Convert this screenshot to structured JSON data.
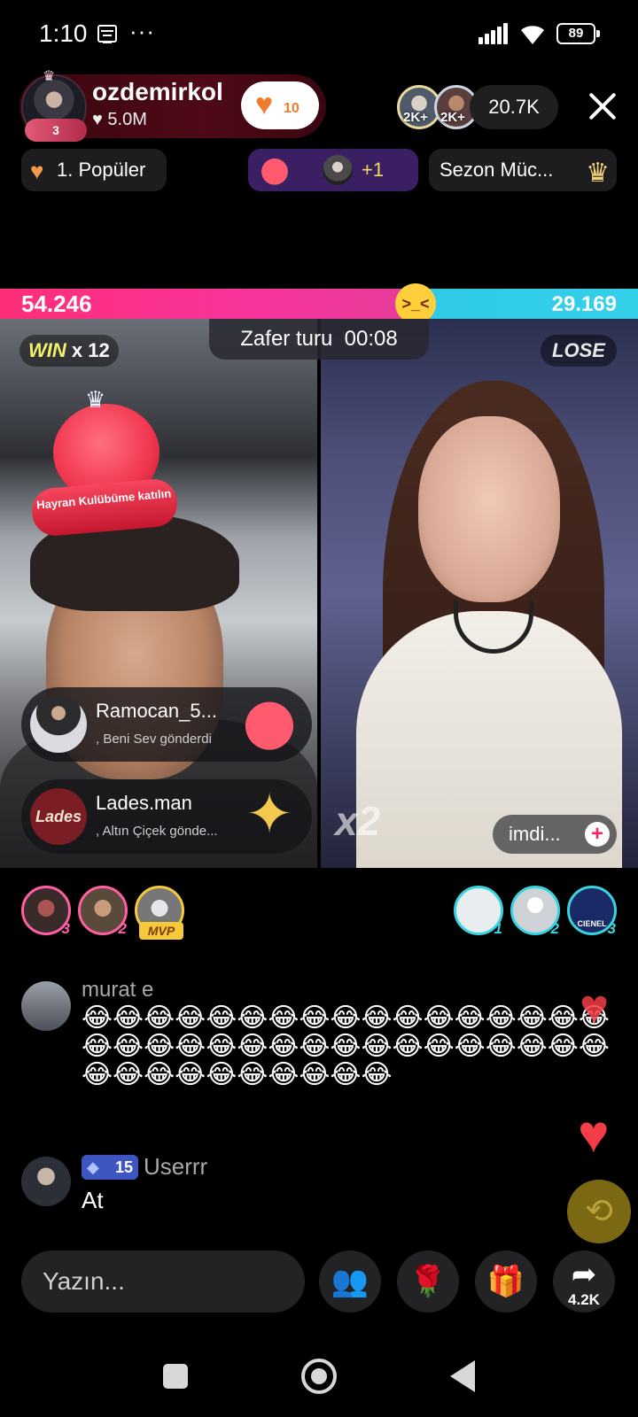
{
  "status_bar": {
    "time": "1:10",
    "more": "···",
    "battery": "89",
    "icons": [
      "calendar-icon",
      "signal-icon",
      "wifi-icon",
      "battery-icon"
    ]
  },
  "host": {
    "name": "ozdemirkol",
    "likes": "♥ 5.0M",
    "badge_level": "3",
    "follow_count": "10"
  },
  "viewers": {
    "top_badges": [
      "2K+",
      "2K+"
    ],
    "count": "20.7K"
  },
  "chips": {
    "popular": "1. Popüler",
    "gift_extra": "+1",
    "season": "Sezon Müc..."
  },
  "battle": {
    "score_left": "54.246",
    "score_right": "29.169",
    "score_emoji": ">_<",
    "timer_label": "Zafer turu",
    "timer_value": "00:08",
    "win_word": "WIN",
    "win_streak": "x 12",
    "lose_word": "LOSE",
    "multiplier": "x2",
    "fanclub_text": "Hayran Kulübüme katılın",
    "invite": "imdi..."
  },
  "gift_toasts": [
    {
      "name": "Ramocan_5...",
      "sub": ", Beni Sev  gönderdi"
    },
    {
      "name": "Lades.man",
      "sub": ", Altın Çiçek  gönde...",
      "avatar_text": "Lades"
    }
  ],
  "ranks": {
    "left": [
      "3",
      "2",
      "MVP"
    ],
    "right": [
      "1",
      "2",
      "3"
    ],
    "right_label": "CIENEL"
  },
  "chat": [
    {
      "user": "murat e",
      "text": "😂😂😂😂😂😂😂😂😂😂😂😂😂😂😂😂😂😂😂😂😂😂😂😂😂😂😂😂😂😂😂😂😂😂😂😂😂😂😂😂😂😂😂😂"
    },
    {
      "user": "Userrr",
      "level": "15",
      "text": "At"
    }
  ],
  "bottom_bar": {
    "placeholder": "Yazın...",
    "share_count": "4.2K",
    "icons": [
      "friends-icon",
      "rose-gift-icon",
      "gift-box-icon",
      "share-icon"
    ]
  },
  "colors": {
    "score_left": "#ff2e78",
    "score_right": "#34d0ea",
    "accent_pink": "#f2296e"
  }
}
